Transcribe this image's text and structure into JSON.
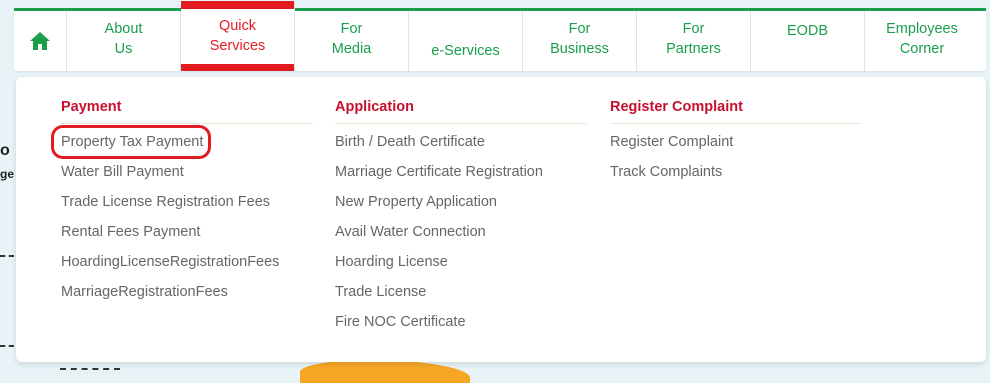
{
  "nav": {
    "home_icon": "home-icon",
    "items": [
      {
        "label": "About\nUs"
      },
      {
        "label": "Quick\nServices"
      },
      {
        "label": "For\nMedia"
      },
      {
        "label": "e-Services"
      },
      {
        "label": "For\nBusiness"
      },
      {
        "label": "For\nPartners"
      },
      {
        "label": "EODB"
      },
      {
        "label": "Employees\nCorner"
      }
    ]
  },
  "dropdown": {
    "columns": [
      {
        "heading": "Payment",
        "links": [
          "Property Tax Payment",
          "Water Bill Payment",
          "Trade License Registration Fees",
          "Rental Fees Payment",
          "HoardingLicenseRegistrationFees",
          "MarriageRegistrationFees"
        ]
      },
      {
        "heading": "Application",
        "links": [
          "Birth / Death Certificate",
          "Marriage Certificate Registration",
          "New Property Application",
          "Avail Water Connection",
          "Hoarding License",
          "Trade License",
          "Fire NOC Certificate"
        ]
      },
      {
        "heading": "Register Complaint",
        "links": [
          "Register Complaint",
          "Track Complaints"
        ]
      }
    ]
  },
  "colors": {
    "brand_green": "#1a9e4b",
    "accent_red": "#e21b23",
    "heading_red": "#c8102e"
  },
  "background": {
    "partial_text_1": "o",
    "partial_text_2": "ge"
  }
}
